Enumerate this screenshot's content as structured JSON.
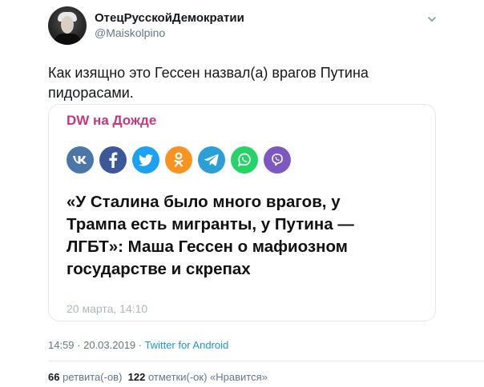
{
  "author": {
    "display_name": "ОтецРусскойДемократии",
    "handle": "@Maiskolpino"
  },
  "tweet": {
    "text_line1": "Как изящно это Гессен назвал(а) врагов Путина",
    "text_line2": "пидорасами."
  },
  "card": {
    "source": "DW на Дожде",
    "share_buttons": [
      {
        "icon": "vk-icon",
        "color": "#4a76a8"
      },
      {
        "icon": "facebook-icon",
        "color": "#3b5998"
      },
      {
        "icon": "twitter-icon",
        "color": "#1da1f2"
      },
      {
        "icon": "odnoklassniki-icon",
        "color": "#f7931e"
      },
      {
        "icon": "telegram-icon",
        "color": "#2a9fd8"
      },
      {
        "icon": "whatsapp-icon",
        "color": "#25d366"
      },
      {
        "icon": "viber-icon",
        "color": "#7c59c1"
      }
    ],
    "headline_lines": [
      "«У Сталина было много врагов, у",
      "Трампа есть мигранты, у Путина —",
      "ЛГБТ»: Маша Гессен о мафиозном",
      "государстве и скрепах"
    ],
    "date": "20 марта, 14:10"
  },
  "meta": {
    "timestamp": "14:59 · 20.03.2019 · ",
    "client": "Twitter for Android"
  },
  "stats": {
    "retweets_count": "66",
    "retweets_label": "ретвита(-ов)",
    "likes_count": "122",
    "likes_label": "отметки(-ок) «Нравится»"
  },
  "colors": {
    "source_accent": "#c6387c",
    "link": "#1b95e0",
    "secondary_text": "#657786"
  }
}
